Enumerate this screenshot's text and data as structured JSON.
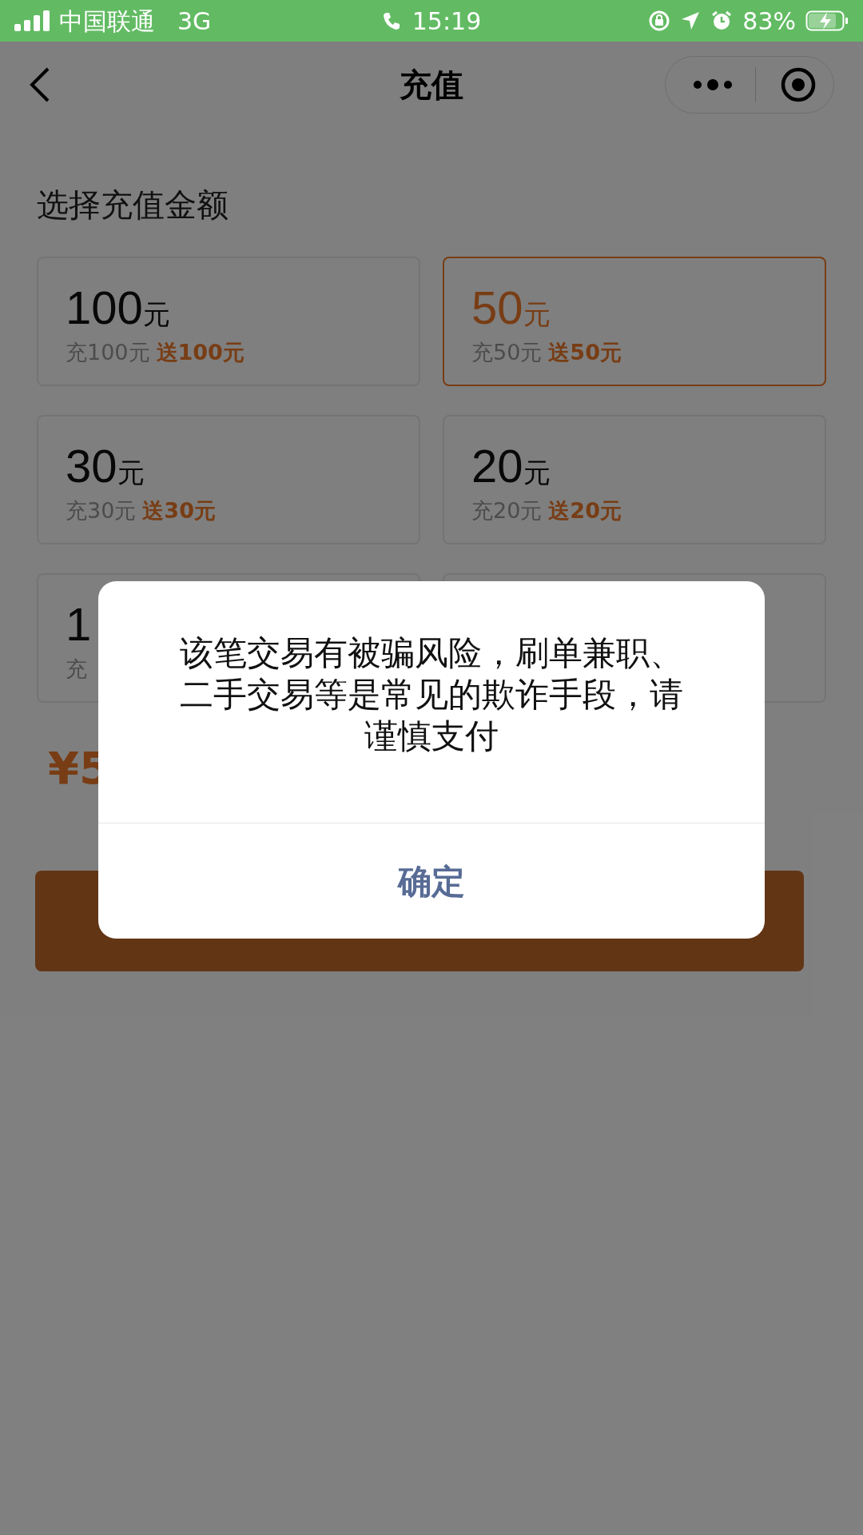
{
  "status_bar": {
    "carrier": "中国联通",
    "network": "3G",
    "time": "15:19",
    "battery": "83%"
  },
  "nav": {
    "title": "充值"
  },
  "section_title": "选择充值金额",
  "options": [
    {
      "amount": "100",
      "unit": "元",
      "pay": "充100元",
      "bonus": "送100元",
      "selected": false
    },
    {
      "amount": "50",
      "unit": "元",
      "pay": "充50元",
      "bonus": "送50元",
      "selected": true
    },
    {
      "amount": "30",
      "unit": "元",
      "pay": "充30元",
      "bonus": "送30元",
      "selected": false
    },
    {
      "amount": "20",
      "unit": "元",
      "pay": "充20元",
      "bonus": "送20元",
      "selected": false
    },
    {
      "amount": "1",
      "pay": "充",
      "selected": false
    },
    {
      "selected": false
    }
  ],
  "total": "¥5",
  "dialog": {
    "message": "该笔交易有被骗风险，刷单兼职、二手交易等是常见的欺诈手段，请谨慎支付",
    "confirm": "确定"
  }
}
